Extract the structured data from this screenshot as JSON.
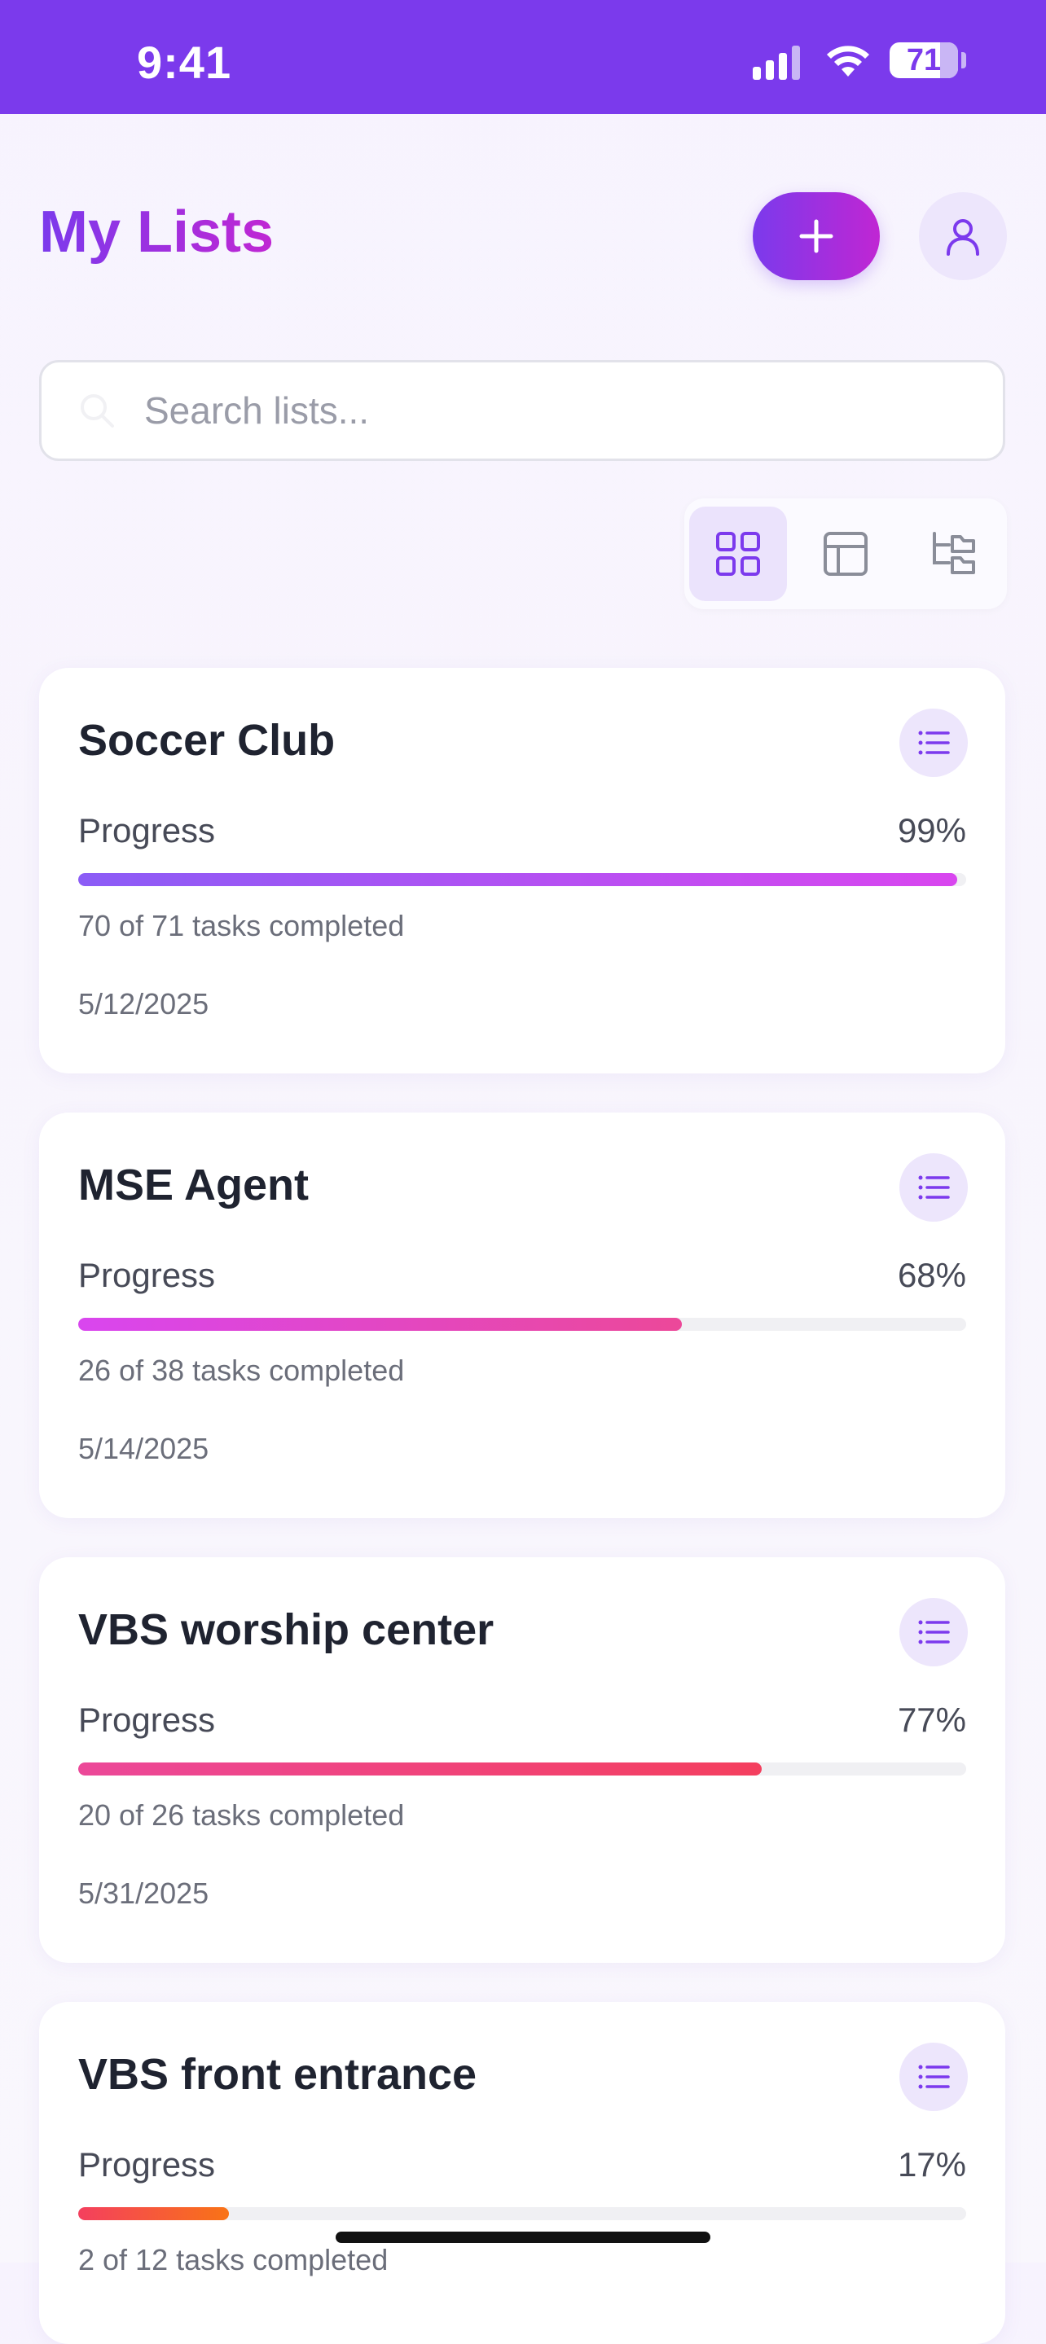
{
  "status_bar": {
    "time": "9:41",
    "battery": "71"
  },
  "header": {
    "title": "My Lists"
  },
  "search": {
    "placeholder": "Search lists..."
  },
  "lists": [
    {
      "title": "Soccer Club",
      "progress_label": "Progress",
      "percent": "99%",
      "fraction": 0.99,
      "tasks": "70 of 71 tasks completed",
      "date": "5/12/2025",
      "gradient": [
        "#8b5cf6",
        "#d946ef"
      ]
    },
    {
      "title": "MSE Agent",
      "progress_label": "Progress",
      "percent": "68%",
      "fraction": 0.68,
      "tasks": "26 of 38 tasks completed",
      "date": "5/14/2025",
      "gradient": [
        "#d946ef",
        "#ec4899"
      ]
    },
    {
      "title": "VBS worship center",
      "progress_label": "Progress",
      "percent": "77%",
      "fraction": 0.77,
      "tasks": "20 of 26 tasks completed",
      "date": "5/31/2025",
      "gradient": [
        "#ec4899",
        "#f43f5e"
      ]
    },
    {
      "title": "VBS front entrance",
      "progress_label": "Progress",
      "percent": "17%",
      "fraction": 0.17,
      "tasks": "2 of 12 tasks completed",
      "date": "",
      "gradient": [
        "#f43f5e",
        "#f97316"
      ]
    }
  ],
  "colors": {
    "accent": "#7b3aec",
    "accent_end": "#c026d3",
    "icon_purple": "#7c3aed"
  }
}
